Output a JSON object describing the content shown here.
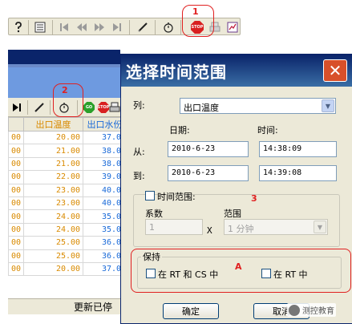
{
  "toolbar": {
    "stop_icon_text": "STOP",
    "go_icon_text": "GO"
  },
  "annotations": {
    "n1": "1",
    "n2": "2",
    "n3": "3",
    "a": "A"
  },
  "grid": {
    "headers": [
      "出口温度",
      "出口水份"
    ],
    "rows": [
      [
        "00",
        "20.00",
        "37.00"
      ],
      [
        "00",
        "21.00",
        "38.00"
      ],
      [
        "00",
        "21.00",
        "38.00"
      ],
      [
        "00",
        "22.00",
        "39.00"
      ],
      [
        "00",
        "23.00",
        "40.00"
      ],
      [
        "00",
        "23.00",
        "40.00"
      ],
      [
        "00",
        "24.00",
        "35.00"
      ],
      [
        "00",
        "24.00",
        "35.00"
      ],
      [
        "00",
        "25.00",
        "36.00"
      ],
      [
        "00",
        "25.00",
        "36.00"
      ],
      [
        "00",
        "20.00",
        "37.00"
      ]
    ],
    "status": "更新已停"
  },
  "dialog": {
    "title": "选择时间范围",
    "column_label": "列:",
    "column_value": "出口温度",
    "date_header": "日期:",
    "time_header": "时间:",
    "from_label": "从:",
    "from_date": "2010-6-23",
    "from_time": "14:38:09",
    "to_label": "到:",
    "to_date": "2010-6-23",
    "to_time": "14:39:08",
    "range_check_label": "时间范围:",
    "coef_label": "系数",
    "coef_value": "1",
    "x_label": "X",
    "range_label": "范围",
    "range_value": "1 分钟",
    "hold_label": "保持",
    "hold_opt1": "在 RT 和 CS 中",
    "hold_opt2": "在 RT 中",
    "ok_label": "确定",
    "cancel_label": "取消"
  },
  "watermark": "测控教育"
}
